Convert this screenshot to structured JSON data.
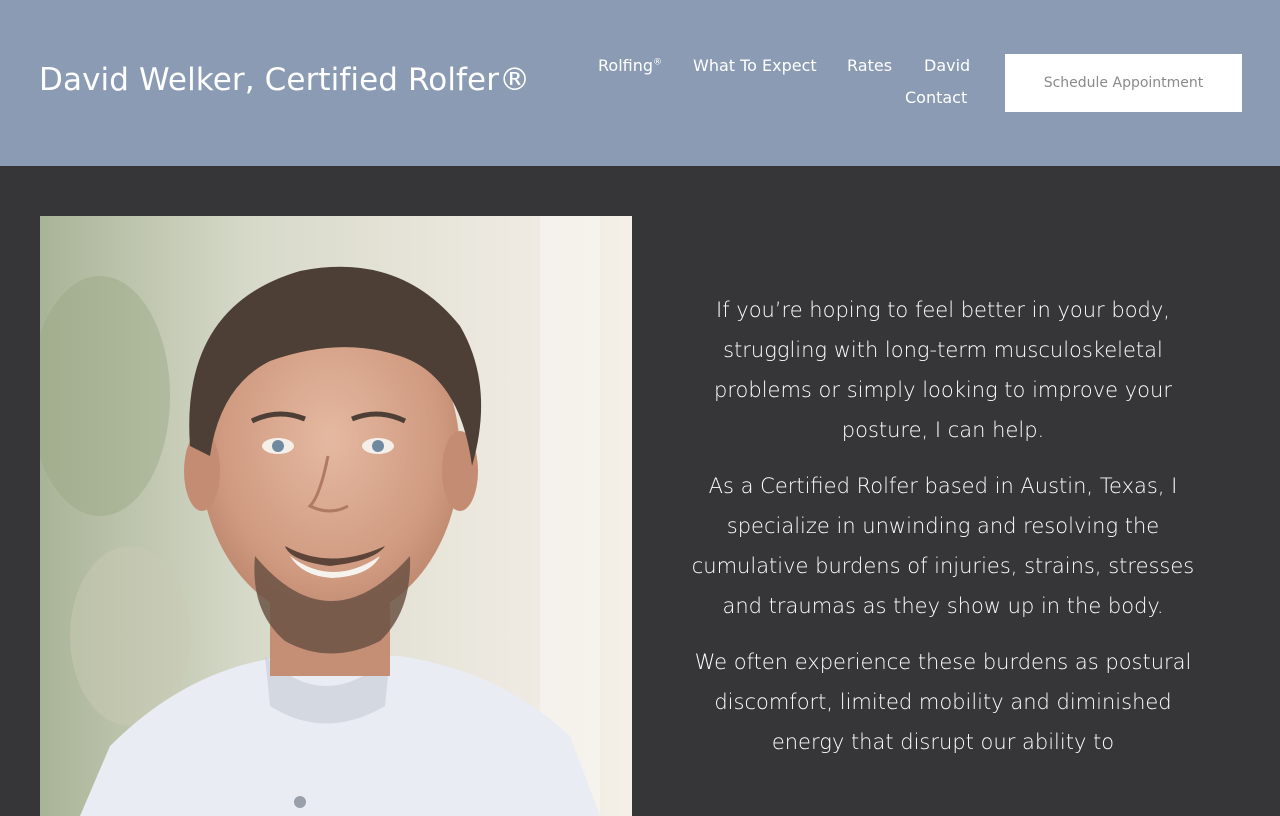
{
  "header": {
    "site_title": "David Welker, Certified Rolfer®",
    "nav": {
      "rolfing": "Rolfing",
      "rolfing_mark": "®",
      "what_to_expect": "What To Expect",
      "rates": "Rates",
      "david": "David",
      "contact": "Contact"
    },
    "cta_label": "Schedule Appointment"
  },
  "intro": {
    "paragraphs": [
      "If you’re hoping to feel better in your body, struggling with long-term musculoskeletal problems or simply looking to improve your posture, I can help.",
      "As a Certified Rolfer based in Austin, Texas, I specialize in unwinding and resolving the cumulative burdens of injuries, strains, stresses and traumas as they show up in the body.",
      "We often experience these burdens as postural discomfort, limited mobility and diminished energy that disrupt our ability to"
    ]
  },
  "colors": {
    "header_bg": "#8a9bb3",
    "body_bg": "#363638",
    "cta_bg": "#ffffff",
    "cta_text": "#8a8a8a",
    "text": "#ffffff"
  }
}
